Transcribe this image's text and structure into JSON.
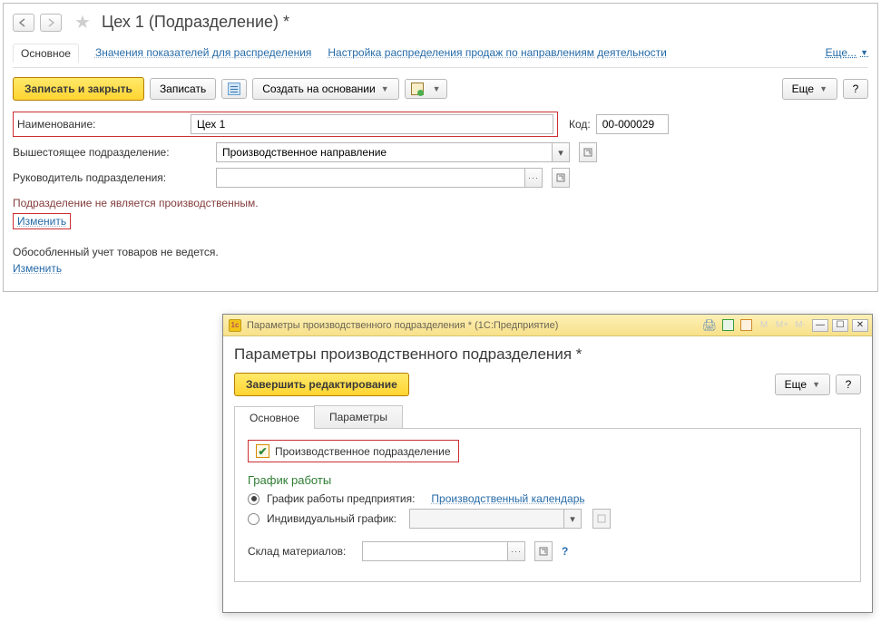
{
  "header": {
    "title": "Цех 1 (Подразделение) *"
  },
  "tabs": {
    "main": "Основное",
    "link1": "Значения показателей для распределения",
    "link2": "Настройка распределения продаж по направлениям деятельности",
    "more": "Еще..."
  },
  "toolbar": {
    "save_close": "Записать и закрыть",
    "save": "Записать",
    "create_based": "Создать на основании",
    "more": "Еще",
    "help": "?"
  },
  "form": {
    "name_label": "Наименование:",
    "name_value": "Цех 1",
    "code_label": "Код:",
    "code_value": "00-000029",
    "parent_label": "Вышестоящее подразделение:",
    "parent_value": "Производственное направление",
    "manager_label": "Руководитель подразделения:",
    "manager_value": ""
  },
  "status1": {
    "text": "Подразделение не является производственным.",
    "change": "Изменить"
  },
  "status2": {
    "text": "Обособленный учет товаров не ведется.",
    "change": "Изменить"
  },
  "dialog": {
    "titlebar": "Параметры производственного подразделения * (1С:Предприятие)",
    "heading": "Параметры производственного подразделения *",
    "finish": "Завершить редактирование",
    "more": "Еще",
    "help": "?",
    "tab_main": "Основное",
    "tab_params": "Параметры",
    "checkbox_label": "Производственное подразделение",
    "section": "График работы",
    "radio1": "График работы предприятия:",
    "radio1_link": "Производственный календарь",
    "radio2": "Индивидуальный график:",
    "materials_label": "Склад материалов:"
  }
}
